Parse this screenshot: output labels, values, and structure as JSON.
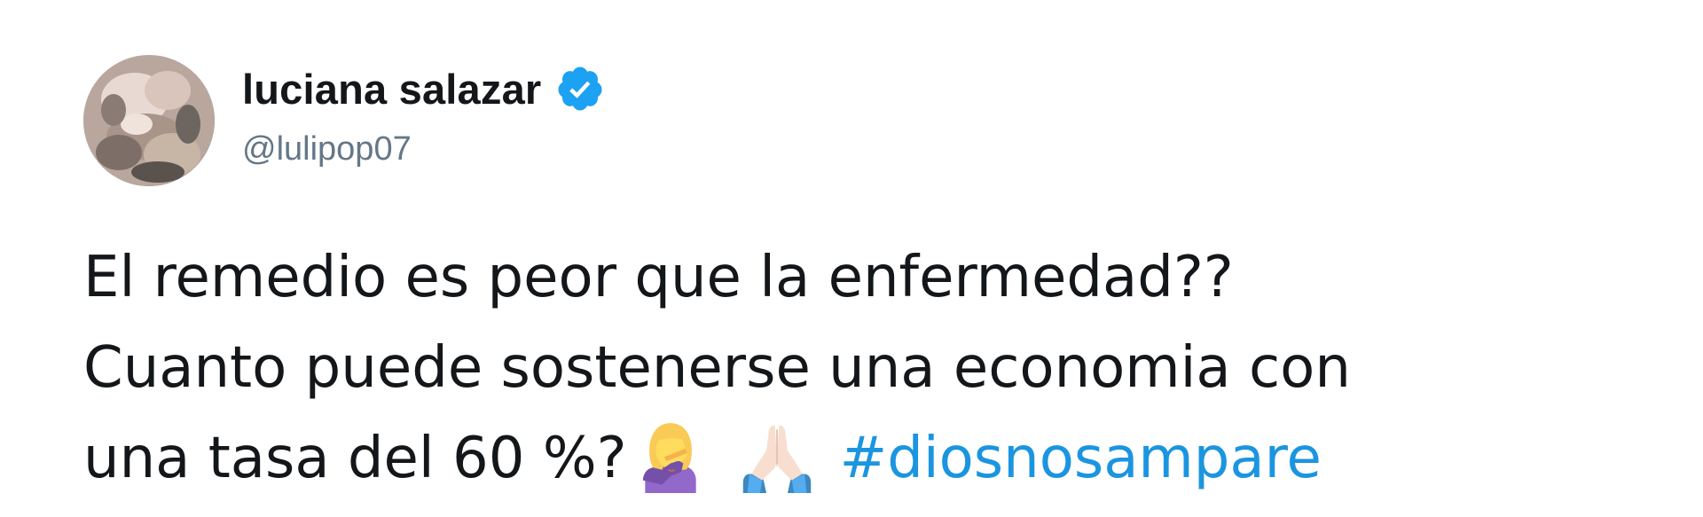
{
  "user": {
    "display_name": "luciana salazar",
    "handle": "@lulipop07",
    "verified": true,
    "verified_color": "#1da1f2"
  },
  "tweet": {
    "line1": "El remedio es peor que la enfermedad??",
    "line2": "Cuanto puede sostenerse una economia con",
    "line3_text": "una tasa del 60 %?",
    "emojis": [
      "woman-facepalming-icon",
      "folded-hands-icon"
    ],
    "hashtag": "#diosnosampare",
    "hashtag_color": "#1b95e0",
    "text_color": "#14171a",
    "handle_color": "#657786"
  }
}
